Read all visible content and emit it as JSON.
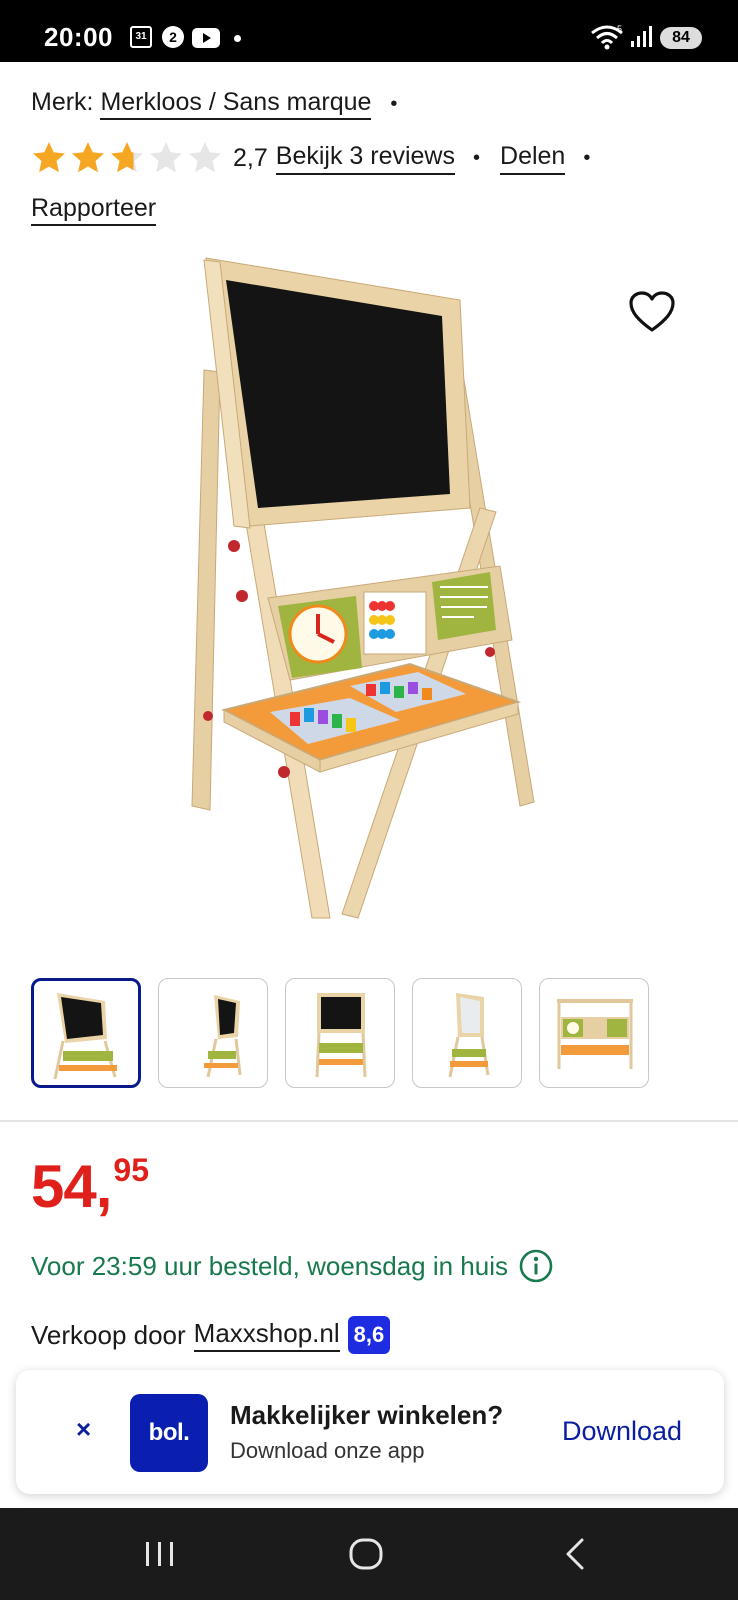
{
  "status_bar": {
    "time": "20:00",
    "calendar_day": "31",
    "notif_badge": "2",
    "battery": "84",
    "network": "5"
  },
  "brand": {
    "label": "Merk:",
    "name": "Merkloos / Sans marque"
  },
  "rating": {
    "value": "2,7",
    "stars_filled": 2.7,
    "stars_total": 5,
    "reviews_link": "Bekijk 3 reviews",
    "share_link": "Delen",
    "report_link": "Rapporteer"
  },
  "gallery": {
    "active_index": 0,
    "thumbnail_count": 5
  },
  "price": {
    "integer": "54,",
    "decimals": "95"
  },
  "delivery": {
    "text": "Voor 23:59 uur besteld, woensdag in huis"
  },
  "seller": {
    "label": "Verkoop door",
    "name": "Maxxshop.nl",
    "score": "8,6"
  },
  "app_banner": {
    "close": "×",
    "logo": "bol.",
    "title": "Makkelijker winkelen?",
    "subtitle": "Download onze app",
    "action": "Download"
  },
  "colors": {
    "price": "#e0211b",
    "delivery": "#187a4c",
    "brand_blue": "#0a1fb0",
    "seller_score": "#1d2ce0",
    "star": "#f5a623"
  }
}
